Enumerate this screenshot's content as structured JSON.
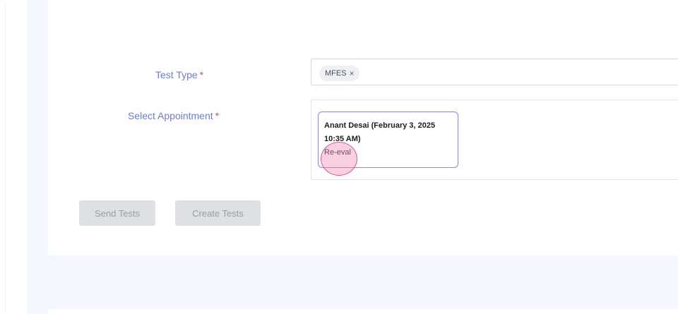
{
  "form": {
    "test_type_label": "Test Type",
    "select_appointment_label": "Select Appointment",
    "required_marker": "*",
    "test_type_chip": "MFES",
    "chip_remove_glyph": "×",
    "appointment": {
      "title": "Anant Desai (February 3, 2025 10:35 AM)",
      "type": "Re-eval"
    }
  },
  "actions": {
    "send_tests_label": "Send Tests",
    "create_tests_label": "Create Tests"
  },
  "colors": {
    "label": "#6c7ce0",
    "required": "#e5484d",
    "appointment_border": "#8b86f0",
    "disabled_button": "#dfe0e3",
    "page_background": "#f5f7fe"
  }
}
